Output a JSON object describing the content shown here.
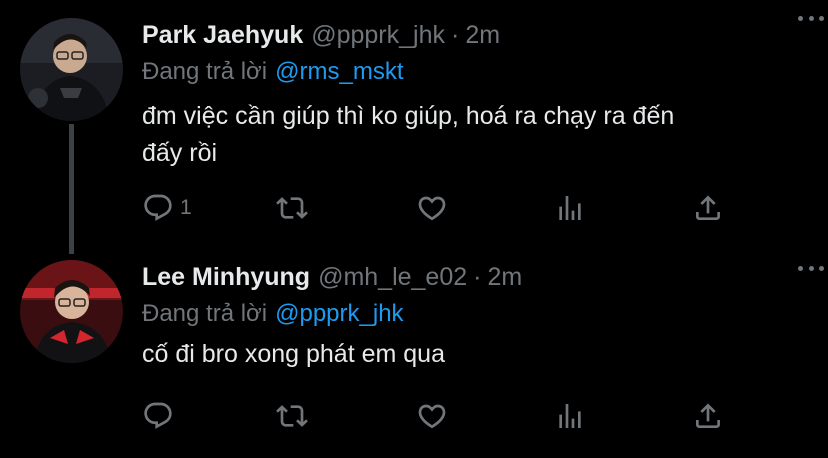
{
  "colors": {
    "background": "#000000",
    "text": "#e7e9ea",
    "muted": "#71767b",
    "link": "#1d9bf0",
    "thread_line": "#3e4144"
  },
  "tweets": [
    {
      "display_name": "Park Jaehyuk",
      "handle": "@ppprk_jhk",
      "separator": "·",
      "time": "2m",
      "reply_prefix": "Đang trả lời",
      "reply_to": "@rms_mskt",
      "text": "đm việc cần giúp thì ko giúp, hoá ra chạy ra đến\nđấy rồi",
      "reply_count": "1",
      "icons": [
        "reply-icon",
        "retweet-icon",
        "like-icon",
        "views-icon",
        "share-icon"
      ]
    },
    {
      "display_name": "Lee Minhyung",
      "handle": "@mh_le_e02",
      "separator": "·",
      "time": "2m",
      "reply_prefix": "Đang trả lời",
      "reply_to": "@ppprk_jhk",
      "text": "cố đi bro xong phát em qua",
      "reply_count": "",
      "icons": [
        "reply-icon",
        "retweet-icon",
        "like-icon",
        "views-icon",
        "share-icon"
      ]
    }
  ]
}
